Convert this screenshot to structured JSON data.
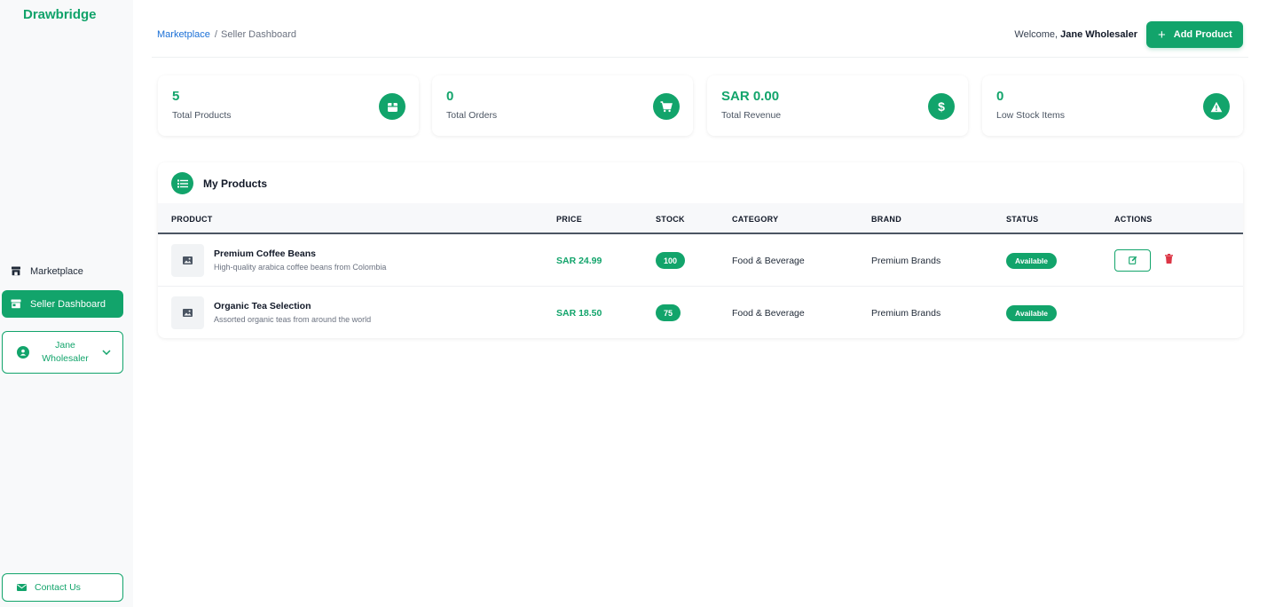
{
  "app": {
    "brand": "Drawbridge"
  },
  "colors": {
    "accent": "#12a46b",
    "link": "#1a6fd6",
    "danger": "#dc3545"
  },
  "sidebar": {
    "items": [
      {
        "label": "Marketplace",
        "icon": "store-icon",
        "active": false
      },
      {
        "label": "Seller Dashboard",
        "icon": "shop-icon",
        "active": true
      }
    ],
    "user": {
      "name": "Jane Wholesaler",
      "icon": "user-circle-icon"
    },
    "contact": {
      "label": "Contact Us",
      "icon": "envelope-icon"
    }
  },
  "header": {
    "breadcrumb": {
      "link": "Marketplace",
      "separator": "/",
      "current": "Seller Dashboard"
    },
    "welcome_prefix": "Welcome,",
    "user_name": "Jane Wholesaler",
    "add_product_label": "Add Product"
  },
  "stats": [
    {
      "value": "5",
      "label": "Total Products",
      "icon": "box-icon"
    },
    {
      "value": "0",
      "label": "Total Orders",
      "icon": "cart-icon"
    },
    {
      "value": "SAR 0.00",
      "label": "Total Revenue",
      "icon": "dollar-icon"
    },
    {
      "value": "0",
      "label": "Low Stock Items",
      "icon": "warning-icon"
    }
  ],
  "products": {
    "title": "My Products",
    "columns": [
      "PRODUCT",
      "PRICE",
      "STOCK",
      "CATEGORY",
      "BRAND",
      "STATUS",
      "ACTIONS"
    ],
    "rows": [
      {
        "name": "Premium Coffee Beans",
        "description": "High-quality arabica coffee beans from Colombia",
        "price": "SAR 24.99",
        "stock": "100",
        "category": "Food & Beverage",
        "brand": "Premium Brands",
        "status": "Available"
      },
      {
        "name": "Organic Tea Selection",
        "description": "Assorted organic teas from around the world",
        "price": "SAR 18.50",
        "stock": "75",
        "category": "Food & Beverage",
        "brand": "Premium Brands",
        "status": "Available"
      }
    ]
  }
}
